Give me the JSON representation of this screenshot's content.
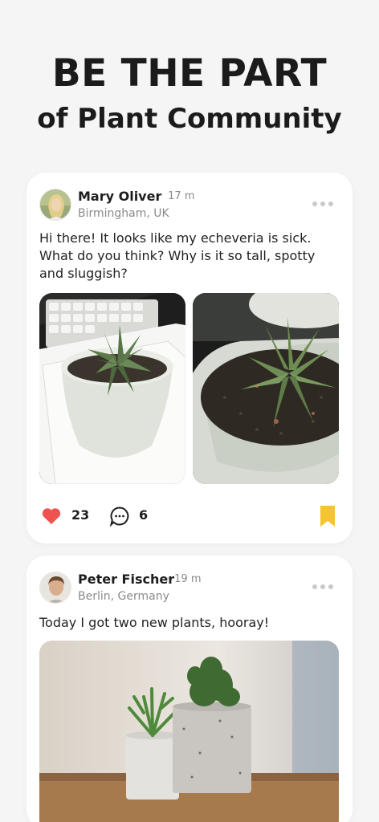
{
  "hero": {
    "title": "BE THE PART",
    "subtitle": "of Plant Community"
  },
  "colors": {
    "background": "#f5f5f5",
    "like": "#ef5350",
    "bookmark": "#f6c431",
    "muted": "#8a8a8a"
  },
  "posts": [
    {
      "author": "Mary Oliver",
      "time": "17 m",
      "location": "Birmingham, UK",
      "text": "Hi there! It looks like my echeveria is sick. What do you think? Why is it so tall, spotty and sluggish?",
      "likes": "23",
      "comments": "6",
      "bookmarked": true,
      "icons": {
        "like": "heart-icon",
        "comment": "comment-bubble-icon",
        "bookmark": "bookmark-icon",
        "more": "more-dots-icon"
      }
    },
    {
      "author": "Peter Fischer",
      "time": "19 m",
      "location": "Berlin, Germany",
      "text": "Today I got two new plants, hooray!",
      "icons": {
        "more": "more-dots-icon"
      }
    }
  ]
}
